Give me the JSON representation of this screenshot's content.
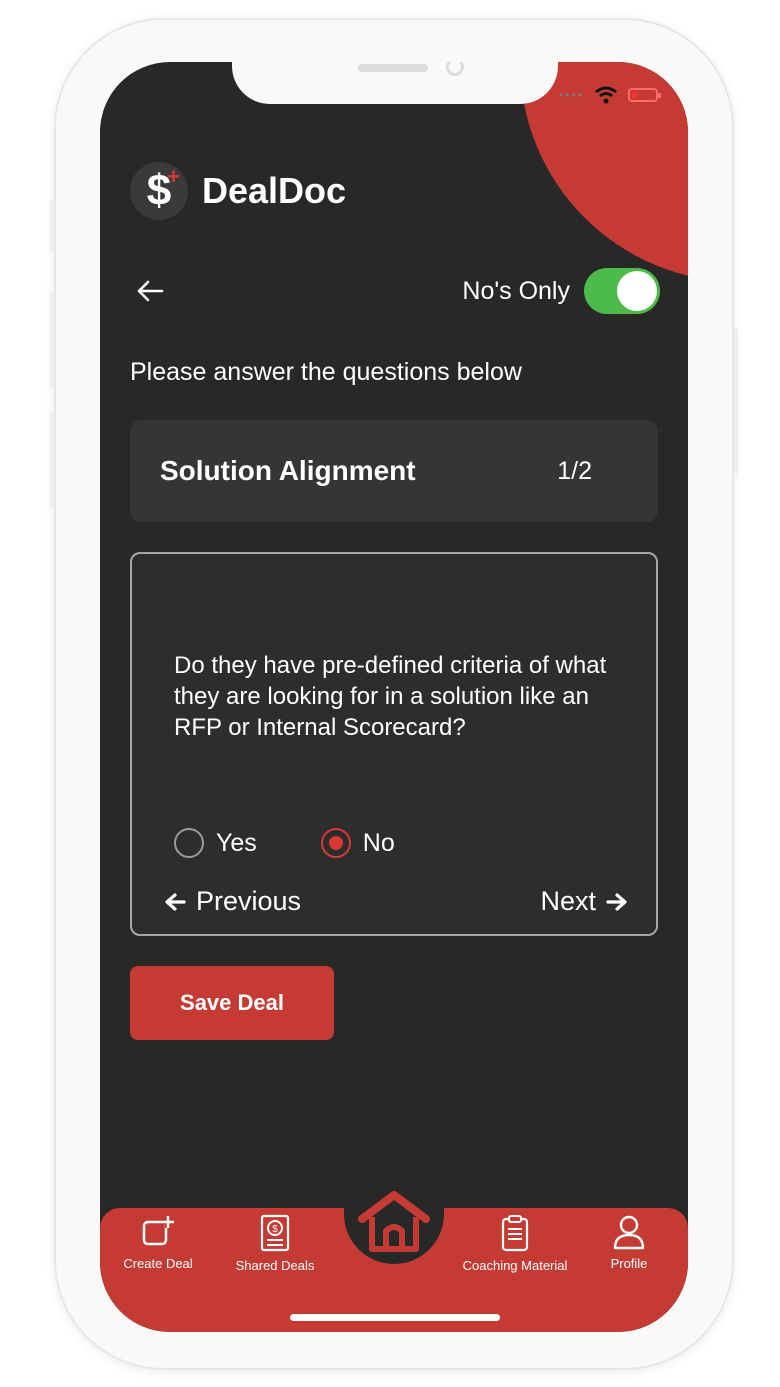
{
  "app": {
    "name": "DealDoc"
  },
  "header": {
    "nos_only_label": "No's Only",
    "nos_only_enabled": true
  },
  "instruction": "Please answer the questions below",
  "section": {
    "title": "Solution Alignment",
    "progress": "1/2"
  },
  "question": {
    "text": "Do they have pre-defined criteria of what they are looking for in a solution like an RFP or Internal Scorecard?",
    "options": [
      {
        "label": "Yes",
        "selected": false
      },
      {
        "label": "No",
        "selected": true
      }
    ],
    "prev_label": "Previous",
    "next_label": "Next"
  },
  "save_label": "Save Deal",
  "tabs": [
    {
      "label": "Create Deal",
      "icon": "create-deal-icon"
    },
    {
      "label": "Shared Deals",
      "icon": "shared-deals-icon"
    },
    {
      "label": "",
      "icon": "home-icon"
    },
    {
      "label": "Coaching Material",
      "icon": "clipboard-icon"
    },
    {
      "label": "Profile",
      "icon": "profile-icon"
    }
  ],
  "colors": {
    "accent": "#c53a33",
    "background": "#282828",
    "toggle_on": "#4cbb4a"
  }
}
